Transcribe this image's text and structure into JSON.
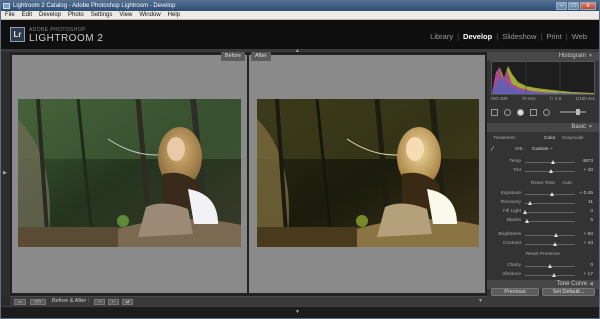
{
  "window": {
    "title": "Lightroom 2 Catalog - Adobe Photoshop Lightroom - Develop"
  },
  "menu": [
    "File",
    "Edit",
    "Develop",
    "Photo",
    "Settings",
    "View",
    "Window",
    "Help"
  ],
  "brand": {
    "badge": "Lr",
    "small": "ADOBE PHOTOSHOP",
    "big": "LIGHTROOM 2"
  },
  "modules": [
    {
      "label": "Library",
      "active": false
    },
    {
      "label": "Develop",
      "active": true
    },
    {
      "label": "Slideshow",
      "active": false
    },
    {
      "label": "Print",
      "active": false
    },
    {
      "label": "Web",
      "active": false
    }
  ],
  "panes": {
    "before": "Before",
    "after": "After"
  },
  "right": {
    "histogram": {
      "title": "Histogram",
      "info": [
        "ISO 400",
        "70 mm",
        "f / 2.8",
        "1/100 sec"
      ]
    },
    "basic": {
      "title": "Basic",
      "treatment_label": "Treatment :",
      "color": "Color",
      "grayscale": "Grayscale",
      "wb_label": "WB :",
      "wb_value": "Custom ÷",
      "temp": {
        "label": "Temp",
        "value": "4973",
        "pos": 0.56
      },
      "tint": {
        "label": "Tint",
        "value": "+ 10",
        "pos": 0.53
      },
      "tone_head": "Reset  Tone",
      "auto": "Auto",
      "tone_rows": [
        {
          "label": "Exposure",
          "value": "+ 0.45",
          "pos": 0.55
        },
        {
          "label": "Recovery",
          "value": "11",
          "pos": 0.1
        },
        {
          "label": "Fill Light",
          "value": "0",
          "pos": 0.0
        },
        {
          "label": "Blacks",
          "value": "5",
          "pos": 0.05
        },
        {
          "label": "Brightness",
          "value": "+ 50",
          "pos": 0.62
        },
        {
          "label": "Contrast",
          "value": "+ 43",
          "pos": 0.6
        }
      ],
      "presence_head": "Reset  Presence",
      "presence_rows": [
        {
          "label": "Clarity",
          "value": "0",
          "pos": 0.5
        },
        {
          "label": "Vibrance",
          "value": "+ 17",
          "pos": 0.58
        },
        {
          "label": "Saturation",
          "value": "0",
          "pos": 0.5
        }
      ]
    },
    "tone_curve": "Tone Curve",
    "previous": "Previous",
    "set_default": "Set Default..."
  },
  "toolbar": {
    "before_after": "Before & After :",
    "yy": "Y|Y"
  },
  "colors": {
    "header": "#0f0f0f",
    "panel": "#333333",
    "pane_bg": "#8a8a8a",
    "active_module": "#ffffff"
  }
}
